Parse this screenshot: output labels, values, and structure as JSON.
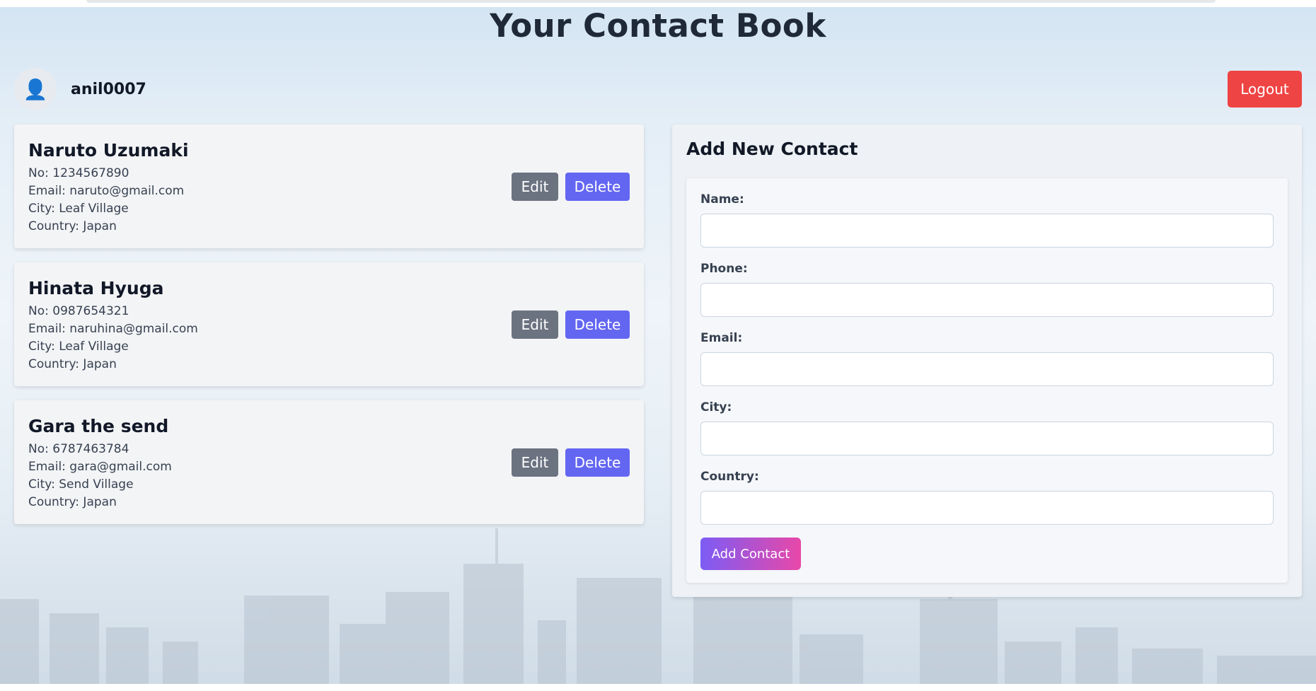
{
  "header": {
    "title": "Your Contact Book"
  },
  "user": {
    "avatar_glyph": "👤",
    "username": "anil0007",
    "logout_label": "Logout"
  },
  "contacts": [
    {
      "name": "Naruto Uzumaki",
      "phone": "No: 1234567890",
      "email": "Email: naruto@gmail.com",
      "city": "City: Leaf Village",
      "country": "Country: Japan",
      "edit_label": "Edit",
      "delete_label": "Delete"
    },
    {
      "name": "Hinata Hyuga",
      "phone": "No: 0987654321",
      "email": "Email: naruhina@gmail.com",
      "city": "City: Leaf Village",
      "country": "Country: Japan",
      "edit_label": "Edit",
      "delete_label": "Delete"
    },
    {
      "name": "Gara the send",
      "phone": "No: 6787463784",
      "email": "Email: gara@gmail.com",
      "city": "City: Send Village",
      "country": "Country: Japan",
      "edit_label": "Edit",
      "delete_label": "Delete"
    }
  ],
  "form": {
    "title": "Add New Contact",
    "name_label": "Name:",
    "name_value": "",
    "phone_label": "Phone:",
    "phone_value": "",
    "email_label": "Email:",
    "email_value": "",
    "city_label": "City:",
    "city_value": "",
    "country_label": "Country:",
    "country_value": "",
    "submit_label": "Add Contact"
  },
  "colors": {
    "logout": "#ef4444",
    "edit": "#6b7280",
    "delete": "#6366f1",
    "gradient_start": "#7c5cf5",
    "gradient_end": "#e848a8"
  },
  "icons": {
    "avatar": "user-icon"
  }
}
